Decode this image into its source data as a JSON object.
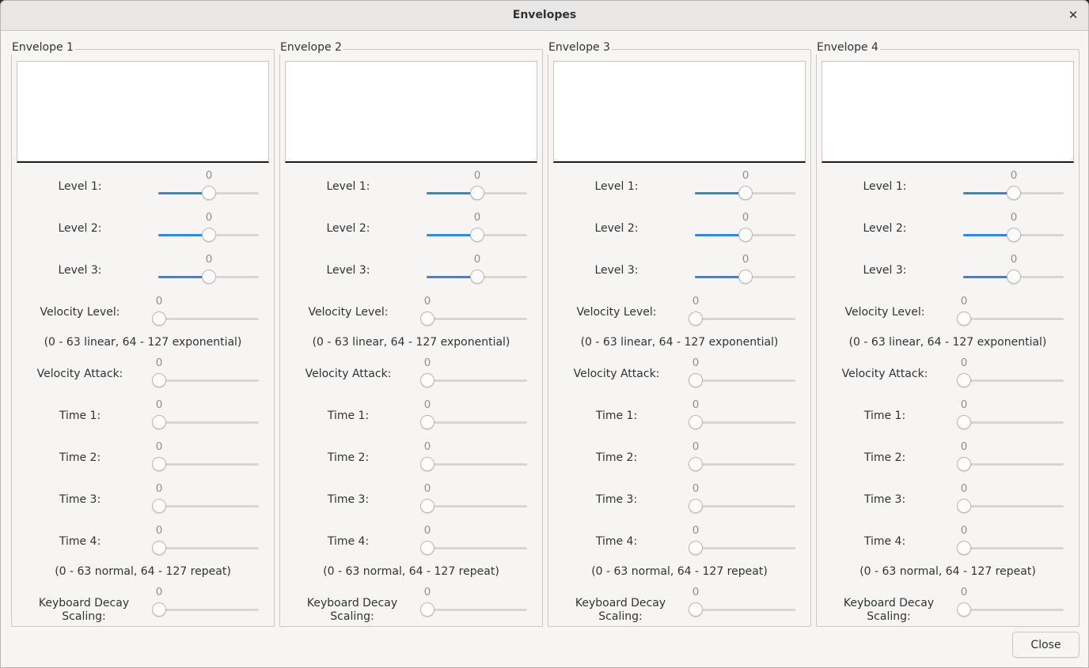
{
  "window": {
    "title": "Envelopes",
    "close_icon": "close-icon"
  },
  "slider_range_note": "levels and velocity level slider values shown",
  "envelopes": [
    {
      "title": "Envelope 1",
      "level1": {
        "label": "Level 1:",
        "value": "0",
        "fill_fraction": 0.5
      },
      "level2": {
        "label": "Level 2:",
        "value": "0",
        "fill_fraction": 0.5
      },
      "level3": {
        "label": "Level 3:",
        "value": "0",
        "fill_fraction": 0.5
      },
      "velocity_level": {
        "label": "Velocity Level:",
        "value": "0",
        "fill_fraction": 0
      },
      "velocity_note": "(0 - 63 linear, 64 - 127 exponential)",
      "velocity_attack": {
        "label": "Velocity Attack:",
        "value": "0",
        "fill_fraction": 0
      },
      "time1": {
        "label": "Time 1:",
        "value": "0",
        "fill_fraction": 0
      },
      "time2": {
        "label": "Time 2:",
        "value": "0",
        "fill_fraction": 0
      },
      "time3": {
        "label": "Time 3:",
        "value": "0",
        "fill_fraction": 0
      },
      "time4": {
        "label": "Time 4:",
        "value": "0",
        "fill_fraction": 0
      },
      "time_note": "(0 - 63 normal, 64 - 127 repeat)",
      "keyboard_decay_scaling": {
        "label": "Keyboard Decay Scaling:",
        "value": "0",
        "fill_fraction": 0
      }
    },
    {
      "title": "Envelope 2",
      "level1": {
        "label": "Level 1:",
        "value": "0",
        "fill_fraction": 0.5
      },
      "level2": {
        "label": "Level 2:",
        "value": "0",
        "fill_fraction": 0.5
      },
      "level3": {
        "label": "Level 3:",
        "value": "0",
        "fill_fraction": 0.5
      },
      "velocity_level": {
        "label": "Velocity Level:",
        "value": "0",
        "fill_fraction": 0
      },
      "velocity_note": "(0 - 63 linear, 64 - 127 exponential)",
      "velocity_attack": {
        "label": "Velocity Attack:",
        "value": "0",
        "fill_fraction": 0
      },
      "time1": {
        "label": "Time 1:",
        "value": "0",
        "fill_fraction": 0
      },
      "time2": {
        "label": "Time 2:",
        "value": "0",
        "fill_fraction": 0
      },
      "time3": {
        "label": "Time 3:",
        "value": "0",
        "fill_fraction": 0
      },
      "time4": {
        "label": "Time 4:",
        "value": "0",
        "fill_fraction": 0
      },
      "time_note": "(0 - 63 normal, 64 - 127 repeat)",
      "keyboard_decay_scaling": {
        "label": "Keyboard Decay Scaling:",
        "value": "0",
        "fill_fraction": 0
      }
    },
    {
      "title": "Envelope 3",
      "level1": {
        "label": "Level 1:",
        "value": "0",
        "fill_fraction": 0.5
      },
      "level2": {
        "label": "Level 2:",
        "value": "0",
        "fill_fraction": 0.5
      },
      "level3": {
        "label": "Level 3:",
        "value": "0",
        "fill_fraction": 0.5
      },
      "velocity_level": {
        "label": "Velocity Level:",
        "value": "0",
        "fill_fraction": 0
      },
      "velocity_note": "(0 - 63 linear, 64 - 127 exponential)",
      "velocity_attack": {
        "label": "Velocity Attack:",
        "value": "0",
        "fill_fraction": 0
      },
      "time1": {
        "label": "Time 1:",
        "value": "0",
        "fill_fraction": 0
      },
      "time2": {
        "label": "Time 2:",
        "value": "0",
        "fill_fraction": 0
      },
      "time3": {
        "label": "Time 3:",
        "value": "0",
        "fill_fraction": 0
      },
      "time4": {
        "label": "Time 4:",
        "value": "0",
        "fill_fraction": 0
      },
      "time_note": "(0 - 63 normal, 64 - 127 repeat)",
      "keyboard_decay_scaling": {
        "label": "Keyboard Decay Scaling:",
        "value": "0",
        "fill_fraction": 0
      }
    },
    {
      "title": "Envelope 4",
      "level1": {
        "label": "Level 1:",
        "value": "0",
        "fill_fraction": 0.5
      },
      "level2": {
        "label": "Level 2:",
        "value": "0",
        "fill_fraction": 0.5
      },
      "level3": {
        "label": "Level 3:",
        "value": "0",
        "fill_fraction": 0.5
      },
      "velocity_level": {
        "label": "Velocity Level:",
        "value": "0",
        "fill_fraction": 0
      },
      "velocity_note": "(0 - 63 linear, 64 - 127 exponential)",
      "velocity_attack": {
        "label": "Velocity Attack:",
        "value": "0",
        "fill_fraction": 0
      },
      "time1": {
        "label": "Time 1:",
        "value": "0",
        "fill_fraction": 0
      },
      "time2": {
        "label": "Time 2:",
        "value": "0",
        "fill_fraction": 0
      },
      "time3": {
        "label": "Time 3:",
        "value": "0",
        "fill_fraction": 0
      },
      "time4": {
        "label": "Time 4:",
        "value": "0",
        "fill_fraction": 0
      },
      "time_note": "(0 - 63 normal, 64 - 127 repeat)",
      "keyboard_decay_scaling": {
        "label": "Keyboard Decay Scaling:",
        "value": "0",
        "fill_fraction": 0
      }
    }
  ],
  "close_button": {
    "label": "Close"
  },
  "colors": {
    "accent": "#3584e4",
    "window_bg": "#f6f5f4",
    "trough": "#d8d6d3"
  }
}
